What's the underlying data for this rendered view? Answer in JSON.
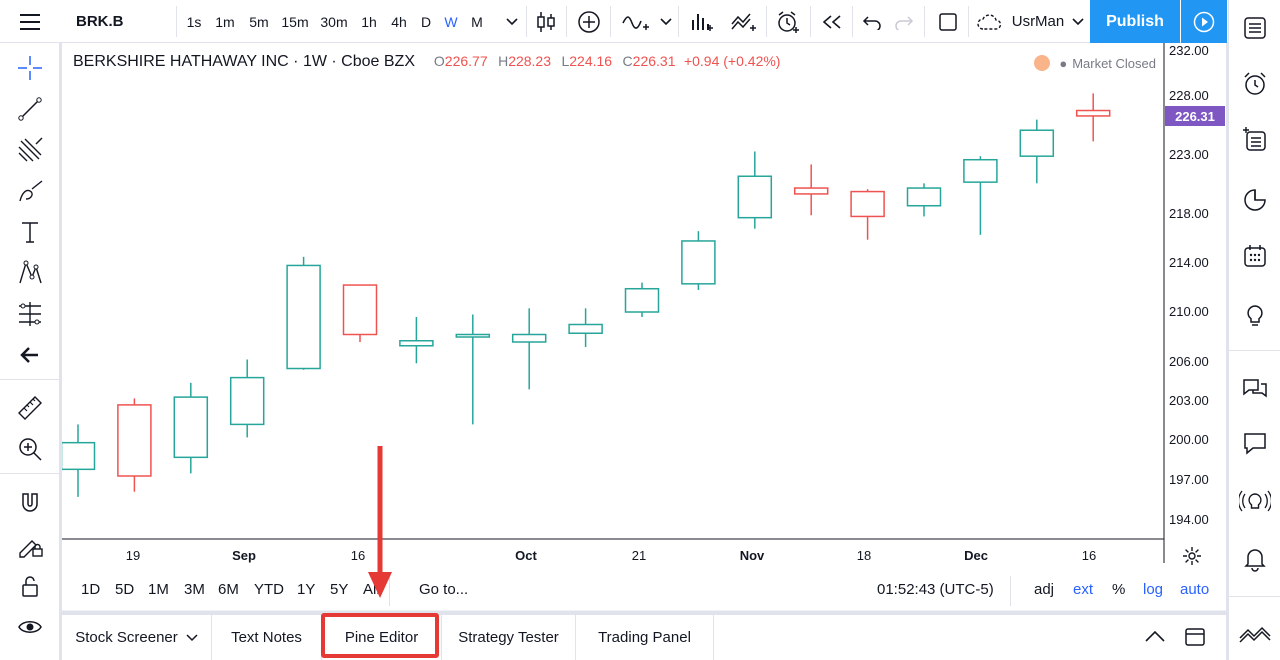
{
  "topbar": {
    "symbol": "BRK.B",
    "intervals": [
      "1s",
      "1m",
      "5m",
      "15m",
      "30m",
      "1h",
      "4h",
      "D",
      "W",
      "M"
    ],
    "active_interval": "W",
    "layout_name": "UsrMan",
    "publish_label": "Publish"
  },
  "legend": {
    "title": "BERKSHIRE HATHAWAY INC · 1W · Cboe BZX",
    "open_label": "O",
    "open": "226.77",
    "high_label": "H",
    "high": "228.23",
    "low_label": "L",
    "low": "224.16",
    "close_label": "C",
    "close": "226.31",
    "change": "+0.94 (+0.42%)",
    "market_status": "Market Closed"
  },
  "price_axis": {
    "labels": [
      "232.00",
      "228.00",
      "223.00",
      "218.00",
      "214.00",
      "210.00",
      "206.00",
      "203.00",
      "200.00",
      "197.00",
      "194.00"
    ],
    "last_price": "226.31"
  },
  "time_axis": {
    "labels": [
      {
        "text": "19",
        "bold": false
      },
      {
        "text": "Sep",
        "bold": true
      },
      {
        "text": "16",
        "bold": false
      },
      {
        "text": "Oct",
        "bold": true
      },
      {
        "text": "21",
        "bold": false
      },
      {
        "text": "Nov",
        "bold": true
      },
      {
        "text": "18",
        "bold": false
      },
      {
        "text": "Dec",
        "bold": true
      },
      {
        "text": "16",
        "bold": false
      }
    ]
  },
  "range_bar": {
    "ranges": [
      "1D",
      "5D",
      "1M",
      "3M",
      "6M",
      "YTD",
      "1Y",
      "5Y",
      "All"
    ],
    "goto_label": "Go to...",
    "clock": "01:52:43 (UTC-5)",
    "adj": "adj",
    "ext": "ext",
    "pct": "%",
    "log": "log",
    "auto": "auto"
  },
  "bottom_tabs": [
    "Stock Screener",
    "Text Notes",
    "Pine Editor",
    "Strategy Tester",
    "Trading Panel"
  ],
  "colors": {
    "up": "#26a69a",
    "down": "#ef5350",
    "accent": "#2962ff",
    "publish": "#2196f3",
    "last_price": "#7e57c2",
    "highlight": "#e53935"
  },
  "chart_data": {
    "type": "candlestick",
    "y_range": [
      192.0,
      233.0
    ],
    "candles": [
      {
        "o": 197.8,
        "h": 201.2,
        "l": 195.7,
        "c": 199.8
      },
      {
        "o": 202.7,
        "h": 203.2,
        "l": 196.1,
        "c": 197.3
      },
      {
        "o": 198.7,
        "h": 204.4,
        "l": 197.5,
        "c": 203.3
      },
      {
        "o": 201.2,
        "h": 206.2,
        "l": 200.2,
        "c": 204.8
      },
      {
        "o": 205.5,
        "h": 214.5,
        "l": 205.4,
        "c": 213.8
      },
      {
        "o": 212.2,
        "h": 212.2,
        "l": 207.6,
        "c": 208.2
      },
      {
        "o": 207.3,
        "h": 209.6,
        "l": 205.9,
        "c": 207.7
      },
      {
        "o": 208.0,
        "h": 209.8,
        "l": 201.2,
        "c": 208.2
      },
      {
        "o": 207.6,
        "h": 210.3,
        "l": 203.9,
        "c": 208.2
      },
      {
        "o": 208.3,
        "h": 210.3,
        "l": 207.2,
        "c": 209.0
      },
      {
        "o": 210.0,
        "h": 212.4,
        "l": 209.6,
        "c": 211.9
      },
      {
        "o": 212.3,
        "h": 216.6,
        "l": 211.8,
        "c": 215.8
      },
      {
        "o": 217.7,
        "h": 223.3,
        "l": 216.8,
        "c": 221.2
      },
      {
        "o": 220.2,
        "h": 222.2,
        "l": 217.9,
        "c": 219.7
      },
      {
        "o": 219.9,
        "h": 220.1,
        "l": 215.9,
        "c": 217.8
      },
      {
        "o": 218.7,
        "h": 220.6,
        "l": 217.8,
        "c": 220.2
      },
      {
        "o": 220.7,
        "h": 222.9,
        "l": 216.3,
        "c": 222.6
      },
      {
        "o": 222.9,
        "h": 226.0,
        "l": 220.6,
        "c": 225.1
      },
      {
        "o": 226.77,
        "h": 228.23,
        "l": 224.16,
        "c": 226.31
      }
    ]
  }
}
